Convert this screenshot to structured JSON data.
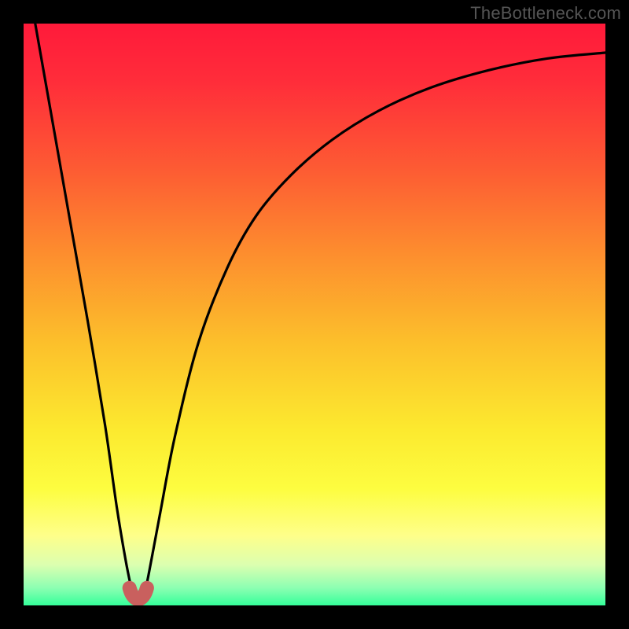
{
  "watermark": {
    "text": "TheBottleneck.com"
  },
  "gradient": {
    "stops": [
      {
        "offset": 0.0,
        "color": "#ff1a3a"
      },
      {
        "offset": 0.1,
        "color": "#ff2d3a"
      },
      {
        "offset": 0.25,
        "color": "#fd5b33"
      },
      {
        "offset": 0.4,
        "color": "#fd8f2e"
      },
      {
        "offset": 0.55,
        "color": "#fcc02b"
      },
      {
        "offset": 0.7,
        "color": "#fcea2f"
      },
      {
        "offset": 0.8,
        "color": "#fdfd40"
      },
      {
        "offset": 0.88,
        "color": "#feff8a"
      },
      {
        "offset": 0.93,
        "color": "#dcffb0"
      },
      {
        "offset": 0.97,
        "color": "#8cffb2"
      },
      {
        "offset": 1.0,
        "color": "#34ff9a"
      }
    ]
  },
  "dip_marker": {
    "color": "#c9605e",
    "stroke_width": 18
  },
  "chart_data": {
    "type": "line",
    "title": "",
    "xlabel": "",
    "ylabel": "",
    "xlim": [
      0,
      100
    ],
    "ylim": [
      0,
      100
    ],
    "series": [
      {
        "name": "bottleneck-curve",
        "x": [
          2,
          5,
          8,
          11,
          14,
          16,
          17.5,
          18.5,
          19,
          19.5,
          20.2,
          21,
          22,
          23.5,
          26,
          30,
          35,
          40,
          46,
          53,
          61,
          70,
          80,
          90,
          100
        ],
        "y": [
          100,
          83,
          66,
          49,
          31,
          17,
          8,
          3,
          1,
          1,
          1,
          3,
          8,
          16,
          29,
          45,
          58,
          67,
          74,
          80,
          85,
          89,
          92,
          94,
          95
        ]
      }
    ],
    "annotations": [
      {
        "type": "dip-marker",
        "x_range": [
          18.2,
          21.2
        ],
        "y": 1.0
      }
    ]
  }
}
